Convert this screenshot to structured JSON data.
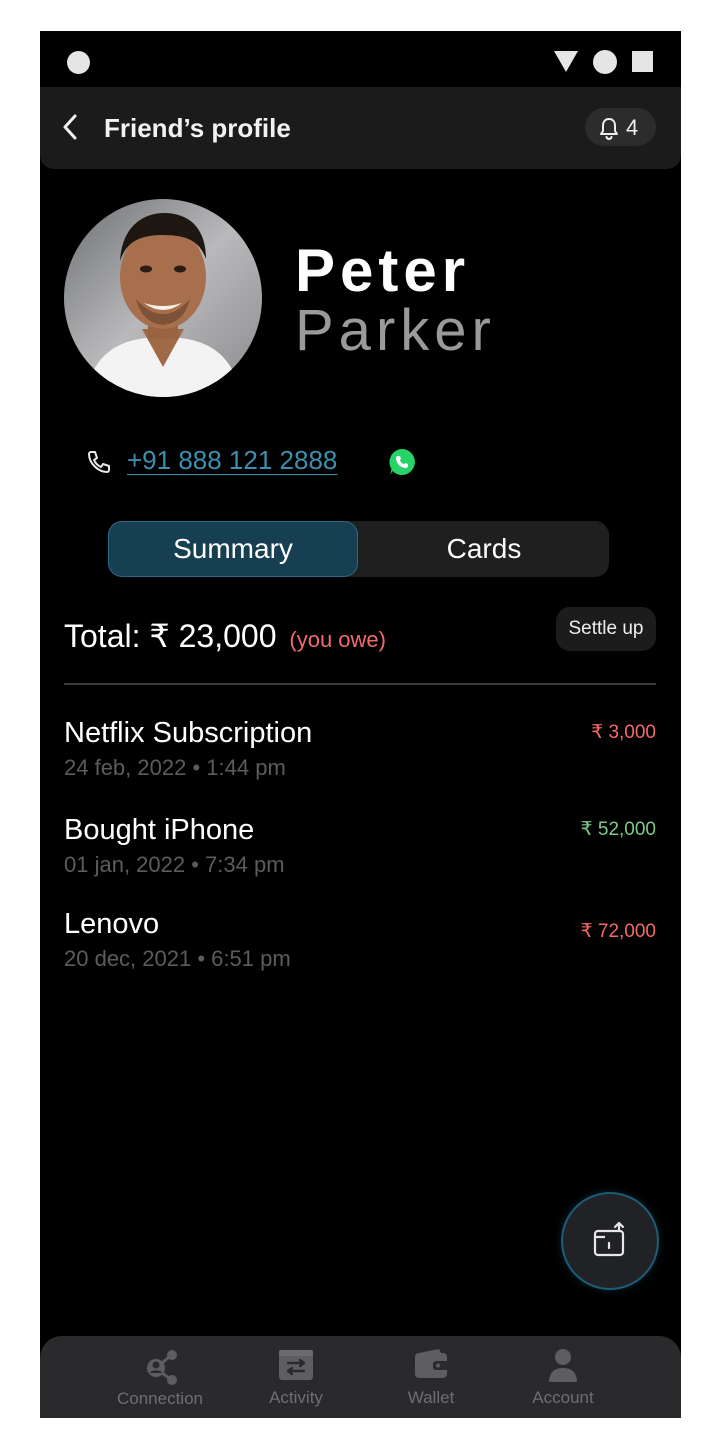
{
  "header": {
    "title": "Friend’s profile",
    "notification_count": "4"
  },
  "profile": {
    "first_name": "Peter",
    "last_name": "Parker",
    "phone": "+91 888 121 2888"
  },
  "tabs": [
    {
      "label": "Summary",
      "active": true
    },
    {
      "label": "Cards",
      "active": false
    }
  ],
  "summary": {
    "total_label": "Total: ₹ 23,000",
    "status": "(you owe)",
    "settle_label": "Settle up"
  },
  "transactions": [
    {
      "name": "Netflix Subscription",
      "date": "24 feb, 2022",
      "time": "1:44 pm",
      "amount": "₹ 3,000",
      "type": "owe"
    },
    {
      "name": "Bought iPhone",
      "date": "01 jan, 2022",
      "time": "7:34 pm",
      "amount": "₹ 52,000",
      "type": "lent"
    },
    {
      "name": "Lenovo",
      "date": "20 dec, 2021",
      "time": "6:51 pm",
      "amount": "₹ 72,000",
      "type": "owe"
    }
  ],
  "nav": [
    {
      "label": "Connection",
      "icon": "connection-icon"
    },
    {
      "label": "Activity",
      "icon": "activity-icon"
    },
    {
      "label": "Wallet",
      "icon": "wallet-icon"
    },
    {
      "label": "Account",
      "icon": "account-icon"
    }
  ],
  "colors": {
    "accent": "#3d8fb0",
    "owe": "#f26a6a",
    "lent": "#7ec98a",
    "tab_active": "#173f52"
  }
}
